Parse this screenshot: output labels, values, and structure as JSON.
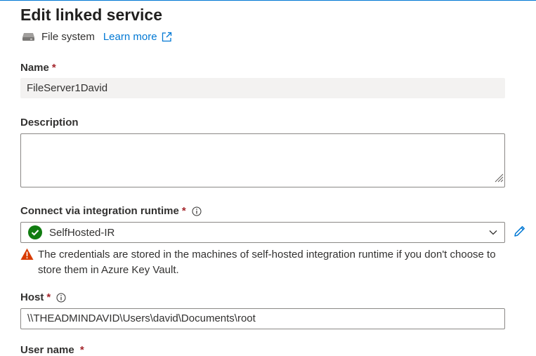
{
  "header": {
    "title": "Edit linked service",
    "service_type": "File system",
    "learn_more": "Learn more"
  },
  "form": {
    "name": {
      "label": "Name",
      "required_mark": "*",
      "value": "FileServer1David"
    },
    "description": {
      "label": "Description",
      "value": ""
    },
    "runtime": {
      "label": "Connect via integration runtime",
      "required_mark": "*",
      "value": "SelfHosted-IR",
      "warning": "The credentials are stored in the machines of self-hosted integration runtime if you don't choose to store them in Azure Key Vault."
    },
    "host": {
      "label": "Host",
      "required_mark": "*",
      "value": "\\\\THEADMINDAVID\\Users\\david\\Documents\\root"
    },
    "next": {
      "label": "User name",
      "required_mark": "*"
    }
  },
  "colors": {
    "accent": "#0078d4",
    "required": "#a4262c",
    "success": "#107c10",
    "warning": "#d83b01"
  },
  "icons": {
    "service": "file-system-icon",
    "external": "external-link-icon",
    "info": "info-icon",
    "status": "check-circle-icon",
    "dropdown": "chevron-down-icon",
    "edit": "pencil-icon",
    "warn": "warning-icon"
  }
}
